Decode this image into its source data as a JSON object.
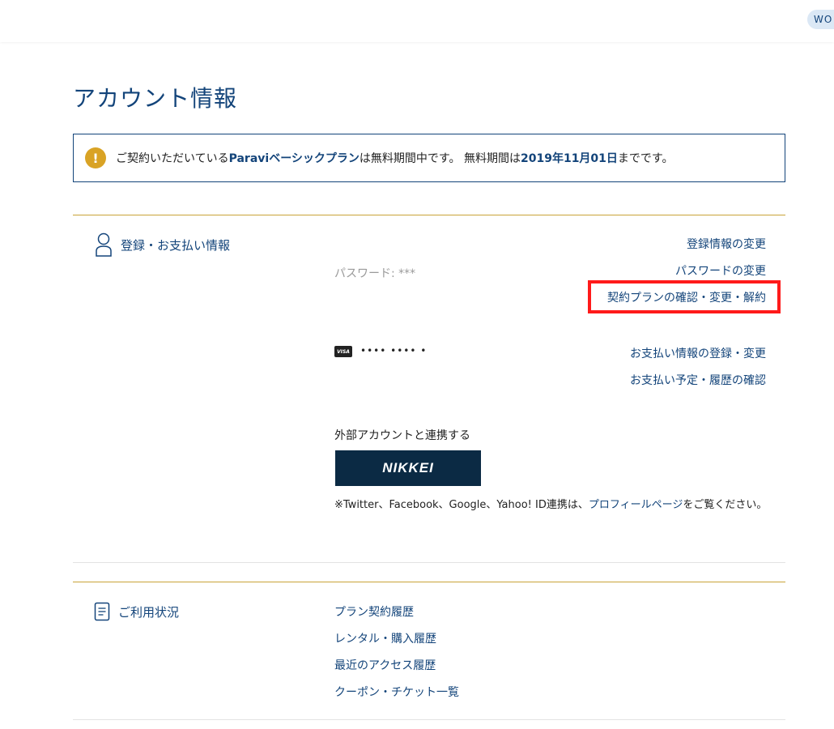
{
  "header": {
    "user_label": "WO"
  },
  "page_title": "アカウント情報",
  "notice": {
    "icon": "warning-icon",
    "prefix": "ご契約いただいている",
    "plan_name": "Paraviベーシックプラン",
    "middle": "は無料期間中です。 無料期間は",
    "end_date": "2019年11月01日",
    "suffix": "までです。"
  },
  "registration": {
    "title": "登録・お支払い情報",
    "icon": "person-icon",
    "password_text": "パスワード: ***",
    "change_registration": "登録情報の変更",
    "change_password": "パスワードの変更",
    "plan_manage": "契約プランの確認・変更・解約",
    "card_brand": "VISA",
    "card_number": "•••• •••• •",
    "payment_change": "お支払い情報の登録・変更",
    "payment_history": "お支払い予定・履歴の確認",
    "external_label": "外部アカウントと連携する",
    "nikkei_label": "NIKKEI",
    "sns_note_prefix": "※Twitter、Facebook、Google、Yahoo! ID連携は、",
    "sns_note_link": "プロフィールページ",
    "sns_note_suffix": "をご覧ください。"
  },
  "usage": {
    "title": "ご利用状況",
    "icon": "document-icon",
    "links": [
      "プラン契約履歴",
      "レンタル・購入履歴",
      "最近のアクセス履歴",
      "クーポン・チケット一覧"
    ]
  },
  "colors": {
    "brand_navy": "#13447a",
    "gold_rule": "#c9a338",
    "warning": "#d9a325",
    "highlight": "#ff1a1a",
    "nikkei_bg": "#0b2a44"
  }
}
